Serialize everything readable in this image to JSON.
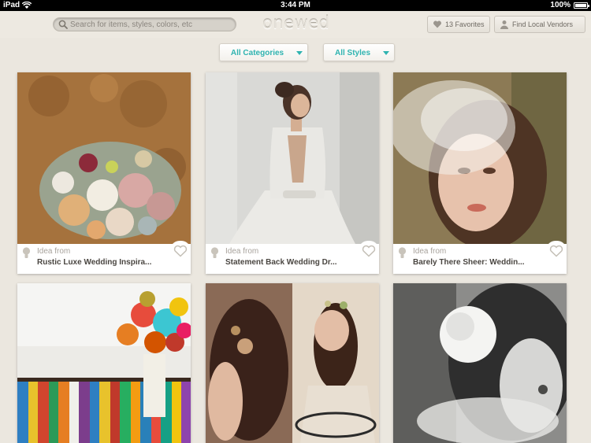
{
  "status_bar": {
    "device": "iPad",
    "time": "3:44 PM",
    "battery": "100%"
  },
  "header": {
    "search_placeholder": "Search for items, styles, colors, etc",
    "logo": "onewed",
    "favorites_label": "13 Favorites",
    "vendors_label": "Find Local Vendors"
  },
  "filters": {
    "categories": "All Categories",
    "styles": "All Styles"
  },
  "cards": [
    {
      "idea_from": "Idea from",
      "title": "Rustic Luxe Wedding Inspira..."
    },
    {
      "idea_from": "Idea from",
      "title": "Statement Back Wedding Dr..."
    },
    {
      "idea_from": "Idea from",
      "title": "Barely There Sheer: Weddin..."
    }
  ],
  "colors": {
    "accent": "#2fb3b0",
    "background": "#ebe7df"
  }
}
